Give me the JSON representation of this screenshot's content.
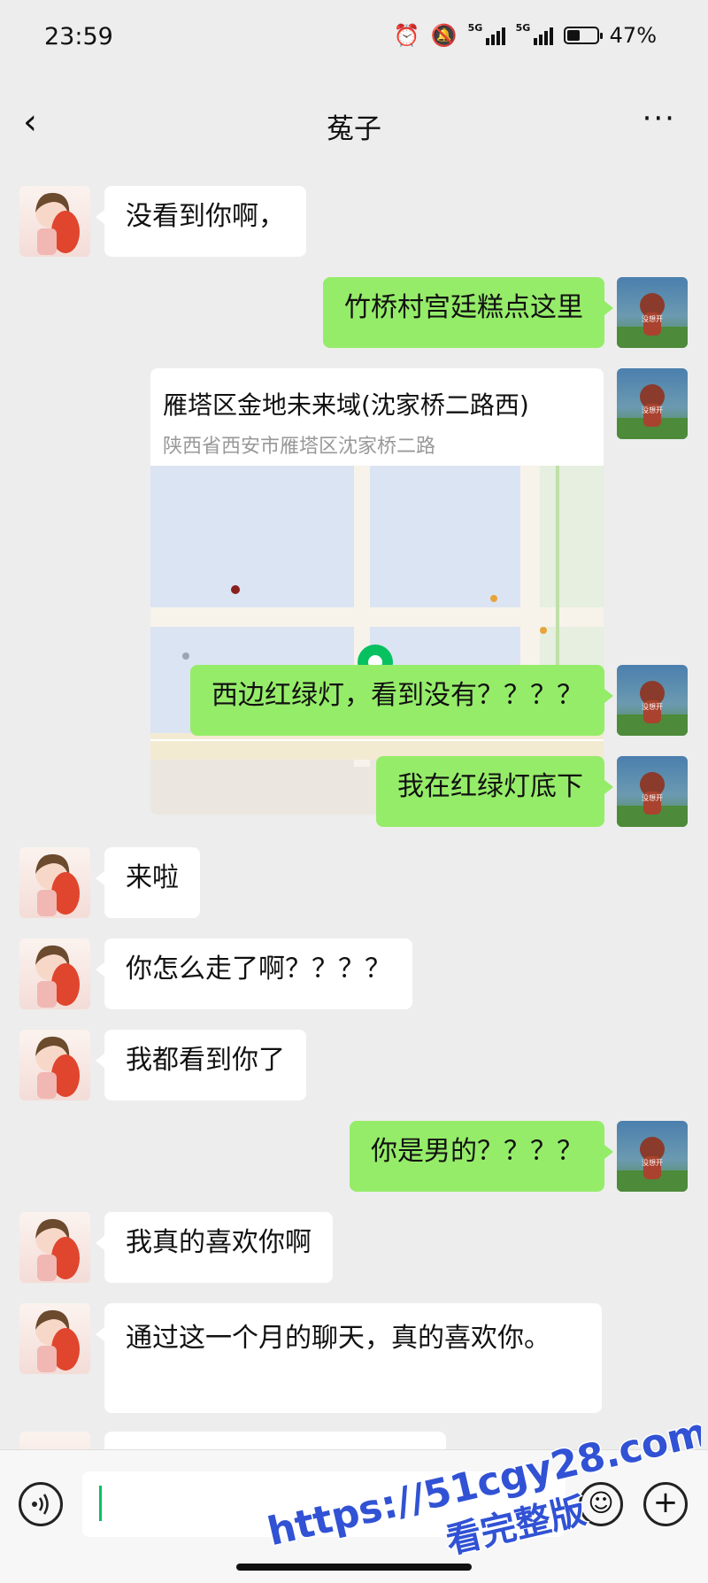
{
  "status_bar": {
    "time": "23:59",
    "network_1": "5G",
    "network_2": "5G",
    "battery": "47%",
    "battery_level": 0.47,
    "icons": [
      "alarm-icon",
      "mute-bell-icon",
      "signal-icon",
      "signal-icon",
      "battery-icon"
    ]
  },
  "header": {
    "back_glyph": "‹",
    "title": "菟子",
    "more_glyph": "···"
  },
  "messages": [
    {
      "side": "left",
      "text": "没看到你啊，"
    },
    {
      "side": "right",
      "text": "竹桥村宫廷糕点这里"
    },
    {
      "side": "right",
      "type": "location",
      "title": "雁塔区金地未来域(沈家桥二路西)",
      "address": "陕西省西安市雁塔区沈家桥二路"
    },
    {
      "side": "right",
      "text": "西边红绿灯，看到没有？？？？"
    },
    {
      "side": "right",
      "text": "我在红绿灯底下"
    },
    {
      "side": "left",
      "text": "来啦"
    },
    {
      "side": "left",
      "text": "你怎么走了啊？？？？"
    },
    {
      "side": "left",
      "text": "我都看到你了"
    },
    {
      "side": "right",
      "text": "你是男的？？？？"
    },
    {
      "side": "left",
      "text": "我真的喜欢你啊"
    },
    {
      "side": "left",
      "text": "通过这一个月的聊天，真的喜欢你。"
    }
  ],
  "input_bar": {
    "voice_icon": "voice-icon",
    "emoji_glyph": "☺",
    "plus_glyph": "+"
  },
  "watermark": {
    "line1": "https://51cgy28.com",
    "line2": "看完整版"
  },
  "colors": {
    "background": "#ededed",
    "my_bubble": "#95ec69",
    "their_bubble": "#ffffff",
    "accent": "#07c160",
    "watermark": "#3152d4"
  }
}
